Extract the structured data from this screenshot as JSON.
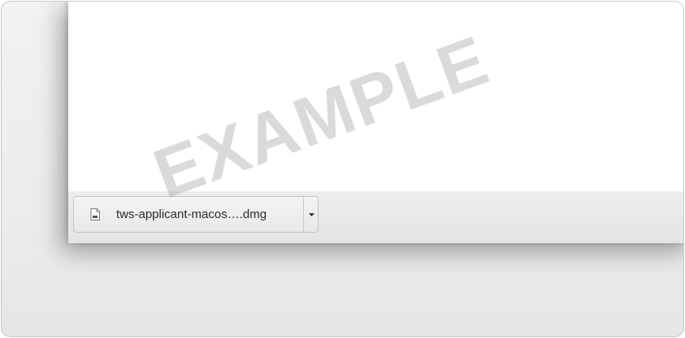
{
  "download_shelf": {
    "item": {
      "file_name": "tws-applicant-macos….dmg",
      "icon": "document-icon",
      "menu_icon": "dropdown-arrow-icon"
    }
  },
  "watermark": {
    "text": "EXAMPLE"
  }
}
